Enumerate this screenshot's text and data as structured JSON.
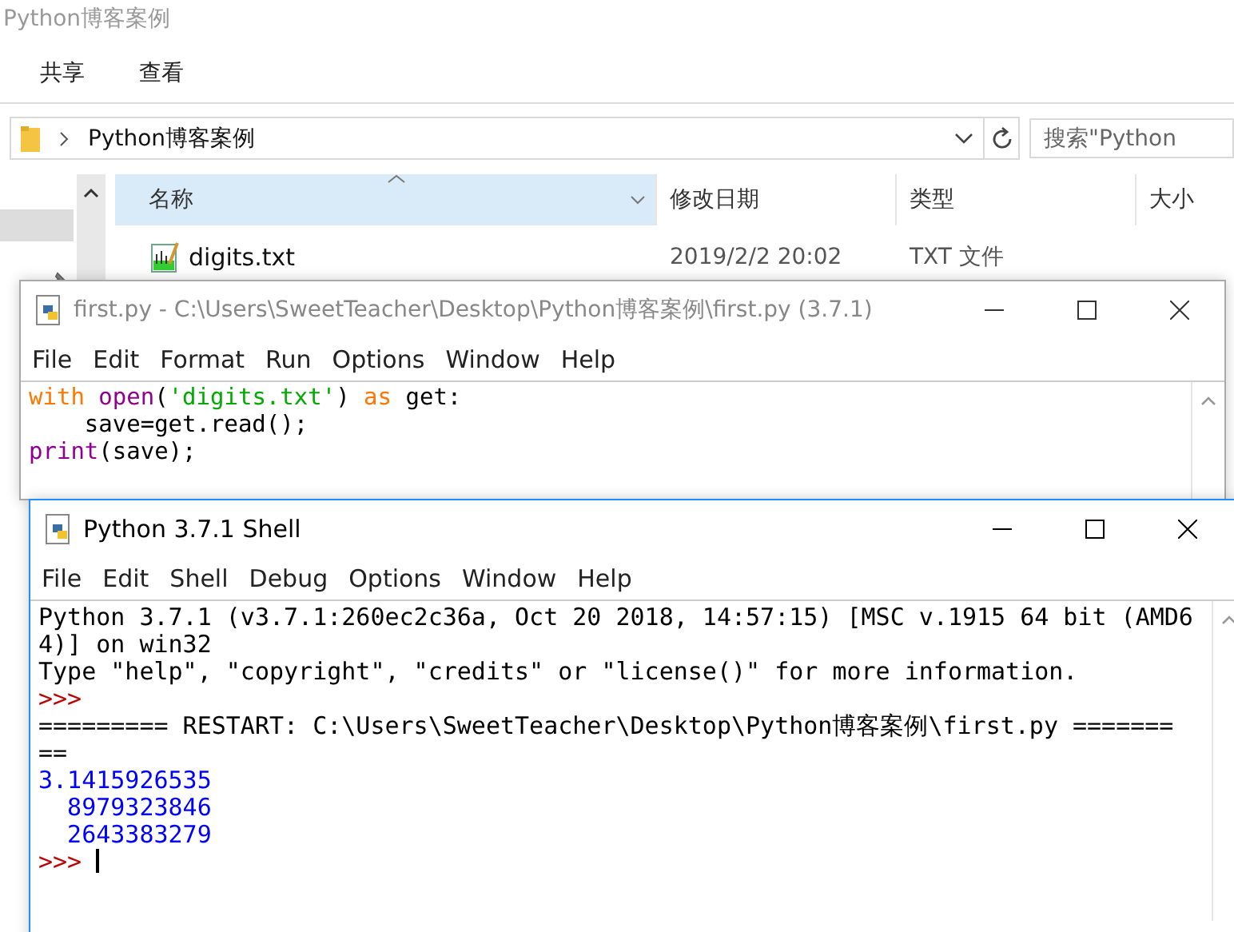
{
  "explorer": {
    "title": "Python博客案例",
    "ribbon_tabs": [
      "共享",
      "查看"
    ],
    "address": "Python博客案例",
    "search": {
      "placeholder": "搜索\"Python"
    },
    "columns": [
      {
        "label": "名称",
        "sorted": true
      },
      {
        "label": "修改日期",
        "sorted": false
      },
      {
        "label": "类型",
        "sorted": false
      },
      {
        "label": "大小",
        "sorted": false
      }
    ],
    "files": [
      {
        "name": "digits.txt",
        "modified": "2019/2/2 20:02",
        "type": "TXT 文件"
      }
    ]
  },
  "editor": {
    "title": "first.py - C:\\Users\\SweetTeacher\\Desktop\\Python博客案例\\first.py (3.7.1)",
    "menu": [
      "File",
      "Edit",
      "Format",
      "Run",
      "Options",
      "Window",
      "Help"
    ],
    "lines": [
      [
        {
          "kind": "keyword",
          "text": "with "
        },
        {
          "kind": "builtin",
          "text": "open"
        },
        {
          "kind": "plain",
          "text": "("
        },
        {
          "kind": "string",
          "text": "'digits.txt'"
        },
        {
          "kind": "plain",
          "text": ") "
        },
        {
          "kind": "keyword",
          "text": "as"
        },
        {
          "kind": "plain",
          "text": " get:"
        }
      ],
      [
        {
          "kind": "plain",
          "text": "    save=get.read();"
        }
      ],
      [
        {
          "kind": "builtin",
          "text": "print"
        },
        {
          "kind": "plain",
          "text": "(save);"
        }
      ]
    ]
  },
  "shell": {
    "title": "Python 3.7.1 Shell",
    "menu": [
      "File",
      "Edit",
      "Shell",
      "Debug",
      "Options",
      "Window",
      "Help"
    ],
    "lines": [
      {
        "kind": "info",
        "text": "Python 3.7.1 (v3.7.1:260ec2c36a, Oct 20 2018, 14:57:15) [MSC v.1915 64 bit (AMD6"
      },
      {
        "kind": "info",
        "text": "4)] on win32"
      },
      {
        "kind": "info",
        "text": "Type \"help\", \"copyright\", \"credits\" or \"license()\" for more information."
      },
      {
        "kind": "prompt",
        "text": ">>>"
      },
      {
        "kind": "info",
        "text": "========= RESTART: C:\\Users\\SweetTeacher\\Desktop\\Python博客案例\\first.py ======="
      },
      {
        "kind": "info",
        "text": "=="
      },
      {
        "kind": "output",
        "text": "3.1415926535"
      },
      {
        "kind": "output",
        "text": "  8979323846"
      },
      {
        "kind": "output",
        "text": "  2643383279"
      },
      {
        "kind": "prompt",
        "text": ">>>",
        "cursor": true
      }
    ]
  }
}
